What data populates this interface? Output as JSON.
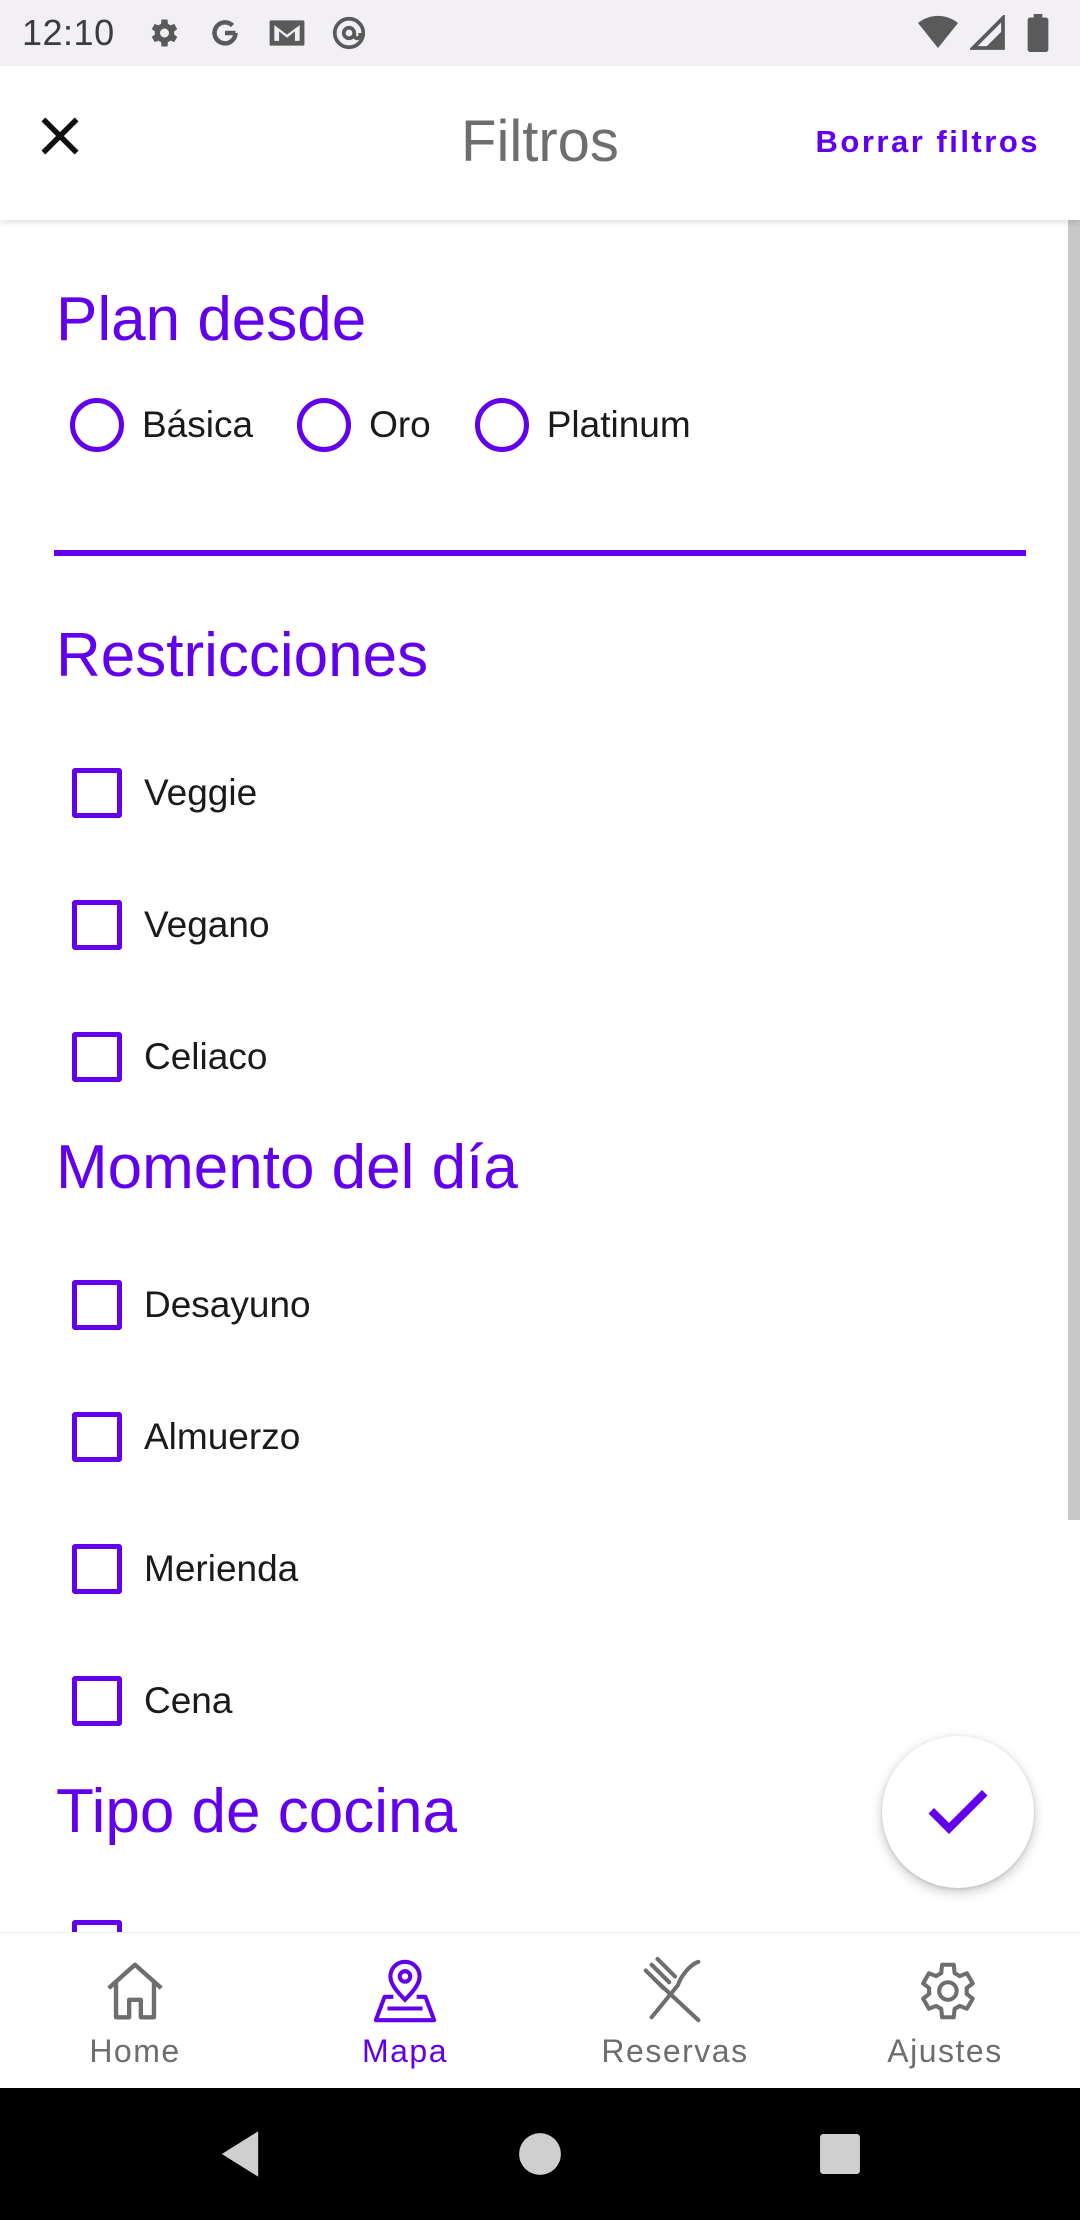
{
  "status_bar": {
    "time": "12:10"
  },
  "app_bar": {
    "title": "Filtros",
    "clear_label": "Borrar filtros"
  },
  "sections": {
    "plan": {
      "title": "Plan desde",
      "options": [
        "Básica",
        "Oro",
        "Platinum"
      ]
    },
    "restricciones": {
      "title": "Restricciones",
      "options": [
        "Veggie",
        "Vegano",
        "Celiaco"
      ]
    },
    "momento": {
      "title": "Momento del día",
      "options": [
        "Desayuno",
        "Almuerzo",
        "Merienda",
        "Cena"
      ]
    },
    "cocina": {
      "title": "Tipo de cocina"
    }
  },
  "bottom_nav": {
    "items": [
      {
        "label": "Home",
        "icon": "home-icon"
      },
      {
        "label": "Mapa",
        "icon": "map-pin-icon"
      },
      {
        "label": "Reservas",
        "icon": "fork-knife-icon"
      },
      {
        "label": "Ajustes",
        "icon": "gear-icon"
      }
    ],
    "active": "Mapa"
  },
  "colors": {
    "accent": "#6200ee",
    "text": "#1a1a1a",
    "muted": "#6e6e6e"
  }
}
